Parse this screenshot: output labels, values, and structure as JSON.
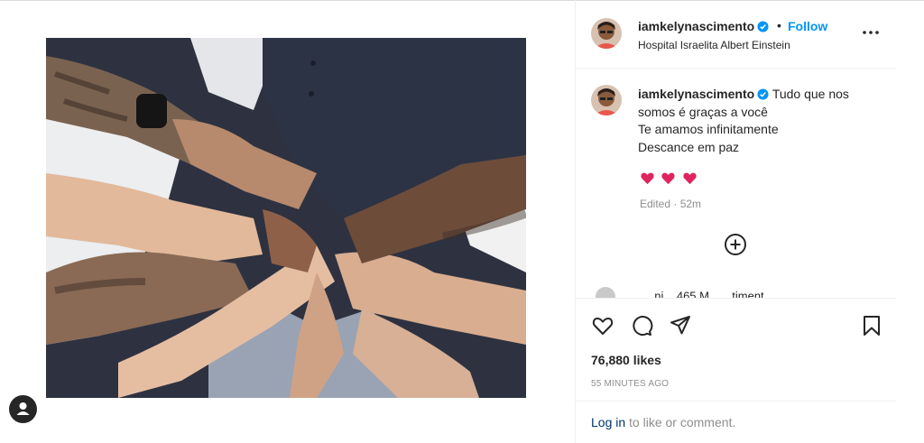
{
  "post": {
    "username": "iamkelynascimento",
    "dot": "•",
    "follow_label": "Follow",
    "location": "Hospital Israelita Albert Einstein",
    "more_icon": "more-horizontal-icon"
  },
  "caption": {
    "username": "iamkelynascimento",
    "lines": [
      "Tudo que nos",
      "somos é graças a você",
      "Te amamos infinitamente",
      "Descance em paz"
    ],
    "hearts": [
      "❤️",
      "❤️",
      "❤️"
    ],
    "edited": "Edited · 52m",
    "partial_comment": "...  ...ni...  465 M... ...timent..."
  },
  "actions": {
    "like_icon": "heart-outline-icon",
    "comment_icon": "comment-icon",
    "share_icon": "send-icon",
    "save_icon": "bookmark-icon",
    "likes": "76,880 likes",
    "time": "55 MINUTES AGO",
    "login_link": "Log in",
    "login_rest": " to like or comment."
  },
  "colors": {
    "link_blue": "#0095f6",
    "verified_blue": "#0095f6",
    "heart_red": "#e0245e",
    "muted": "#8e8e8e"
  }
}
